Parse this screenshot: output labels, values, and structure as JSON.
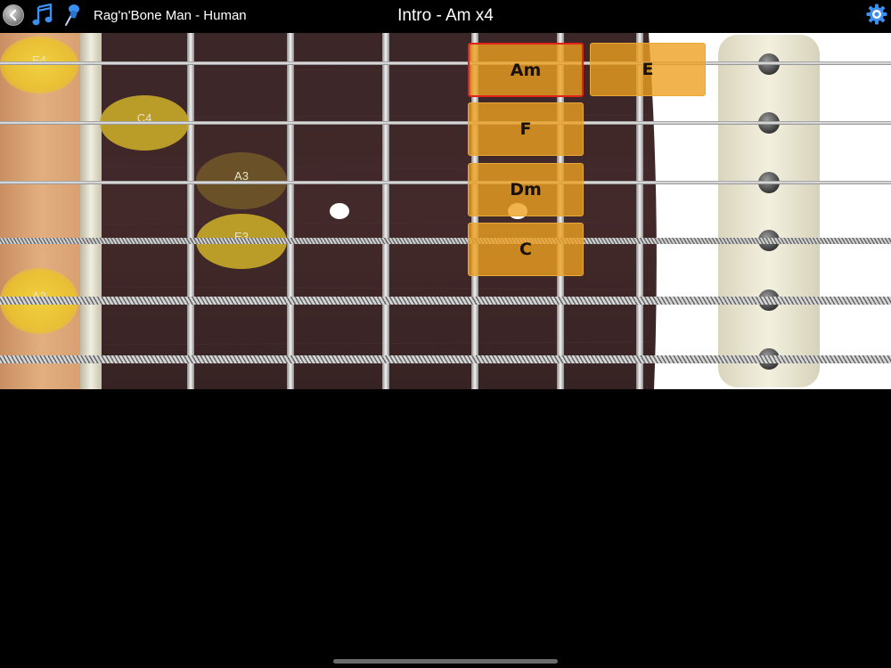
{
  "toolbar": {
    "song_title": "Rag'n'Bone Man - Human",
    "section_title": "Intro - Am x4",
    "icons": [
      "back-icon",
      "music-note-icon",
      "pin-icon",
      "gear-icon"
    ]
  },
  "notes": [
    {
      "label": "E4"
    },
    {
      "label": "C4"
    },
    {
      "label": "A3"
    },
    {
      "label": "E3"
    },
    {
      "label": "A2"
    }
  ],
  "chords": [
    {
      "label": "Am",
      "active": true
    },
    {
      "label": "E",
      "active": false
    },
    {
      "label": "F",
      "active": false
    },
    {
      "label": "Dm",
      "active": false
    },
    {
      "label": "C",
      "active": false
    }
  ],
  "colors": {
    "chord_fill": "#eca020",
    "active_border": "#e3221a",
    "note_highlight": "#e8c22a",
    "fretboard_wood": "#3a2526"
  }
}
